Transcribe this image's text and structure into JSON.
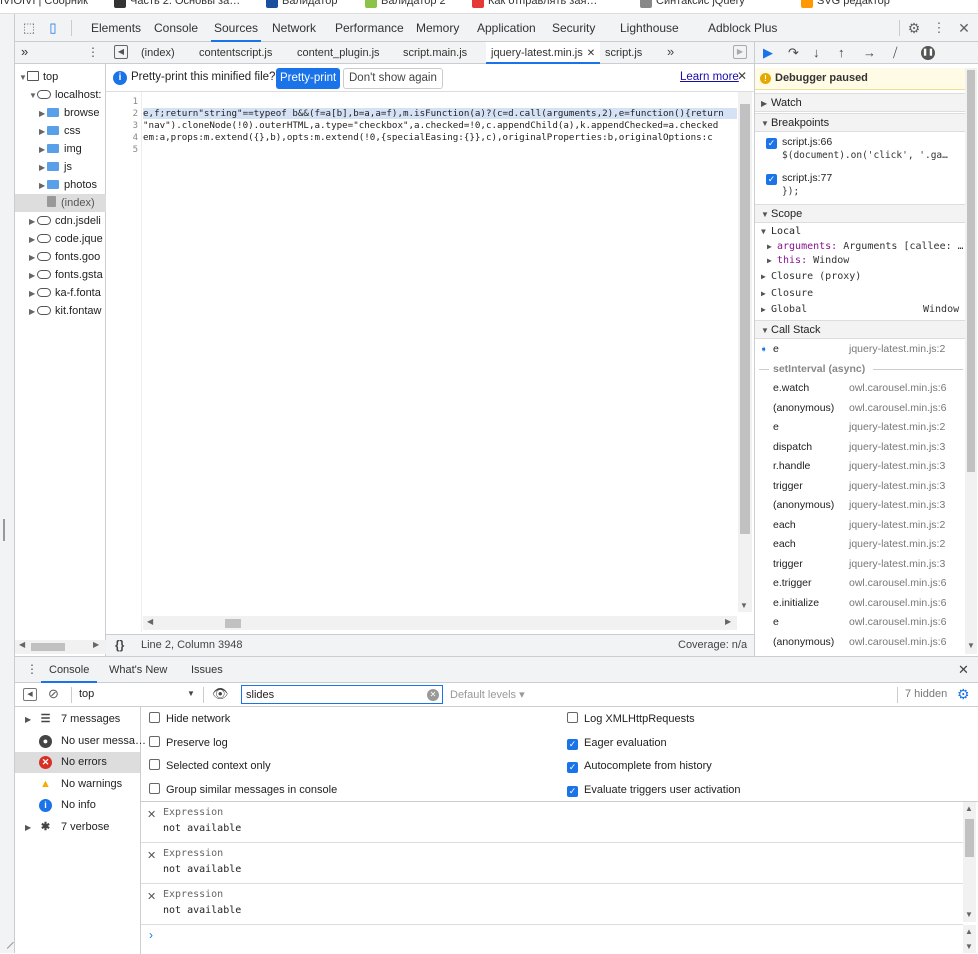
{
  "bookmarks": [
    {
      "label": "IVIOIVI | Сборник",
      "icon_color": "#ffffff"
    },
    {
      "label": "Часть 2. Основы за…",
      "icon_color": "#333333"
    },
    {
      "label": "Валидатор",
      "icon_color": "#1a4fa0"
    },
    {
      "label": "Валидатор 2",
      "icon_color": "#8bc34a"
    },
    {
      "label": "Как отправлять зая…",
      "icon_color": "#e53935"
    },
    {
      "label": "Синтаксис jQuery",
      "icon_color": "#888888"
    },
    {
      "label": "SVG редактор",
      "icon_color": "#ff9800"
    }
  ],
  "toolbar": {
    "tabs": [
      "Elements",
      "Console",
      "Sources",
      "Network",
      "Performance",
      "Memory",
      "Application",
      "Security",
      "Lighthouse",
      "Adblock Plus"
    ],
    "active_tab": "Sources",
    "icons": [
      "inspect-icon",
      "device-toggle-icon",
      "gear-icon",
      "more-icon",
      "close-icon"
    ]
  },
  "navigator": {
    "more": "»",
    "items": [
      {
        "label": "top",
        "type": "frame",
        "expanded": true
      },
      {
        "label": "localhost:",
        "type": "cloud",
        "expanded": true
      },
      {
        "label": "browse",
        "type": "folder"
      },
      {
        "label": "css",
        "type": "folder"
      },
      {
        "label": "img",
        "type": "folder"
      },
      {
        "label": "js",
        "type": "folder"
      },
      {
        "label": "photos",
        "type": "folder"
      },
      {
        "label": "(index)",
        "type": "file"
      },
      {
        "label": "cdn.jsdeli",
        "type": "cloud"
      },
      {
        "label": "code.jque",
        "type": "cloud"
      },
      {
        "label": "fonts.goo",
        "type": "cloud"
      },
      {
        "label": "fonts.gsta",
        "type": "cloud"
      },
      {
        "label": "ka-f.fonta",
        "type": "cloud"
      },
      {
        "label": "kit.fontaw",
        "type": "cloud"
      }
    ]
  },
  "editor": {
    "tabs": [
      "(index)",
      "contentscript.js",
      "content_plugin.js",
      "script.main.js",
      "jquery-latest.min.js",
      "script.js"
    ],
    "active_tab": "jquery-latest.min.js",
    "more": "»",
    "infobar": {
      "text": "Pretty-print this minified file?",
      "pretty_btn": "Pretty-print",
      "dont_btn": "Don't show again",
      "learn": "Learn more"
    },
    "lines": [
      {
        "n": "1",
        "code": ""
      },
      {
        "n": "2",
        "code": "e,f;return\"string\"==typeof b&&(f=a[b],b=a,a=f),m.isFunction(a)?(c=d.call(arguments,2),e=function(){return"
      },
      {
        "n": "3",
        "code": "\"nav\").cloneNode(!0).outerHTML,a.type=\"checkbox\",a.checked=!0,c.appendChild(a),k.appendChecked=a.checked"
      },
      {
        "n": "4",
        "code": "em:a,props:m.extend({},b),opts:m.extend(!0,{specialEasing:{}},c),originalProperties:b,originalOptions:c"
      },
      {
        "n": "5",
        "code": ""
      }
    ],
    "status": {
      "braces": "{}",
      "position": "Line 2, Column 3948",
      "coverage": "Coverage: n/a"
    }
  },
  "debugger": {
    "paused": "Debugger paused",
    "watch": "Watch",
    "breakpoints_title": "Breakpoints",
    "breakpoints": [
      {
        "file": "script.js:66",
        "code": "$(document).on('click', '.ga…"
      },
      {
        "file": "script.js:77",
        "code": "});"
      }
    ],
    "scope_title": "Scope",
    "local": "Local",
    "arguments_key": "arguments:",
    "arguments_val": "Arguments [callee: …",
    "this_key": "this:",
    "this_val": "Window",
    "closure_proxy": "Closure (proxy)",
    "closure": "Closure",
    "global": "Global",
    "global_val": "Window",
    "callstack_title": "Call Stack",
    "async_label": "setInterval (async)",
    "stack": [
      {
        "fn": "e",
        "loc": "jquery-latest.min.js:2",
        "current": true
      },
      {
        "fn": "e.watch",
        "loc": "owl.carousel.min.js:6"
      },
      {
        "fn": "(anonymous)",
        "loc": "owl.carousel.min.js:6"
      },
      {
        "fn": "e",
        "loc": "jquery-latest.min.js:2"
      },
      {
        "fn": "dispatch",
        "loc": "jquery-latest.min.js:3"
      },
      {
        "fn": "r.handle",
        "loc": "jquery-latest.min.js:3"
      },
      {
        "fn": "trigger",
        "loc": "jquery-latest.min.js:3"
      },
      {
        "fn": "(anonymous)",
        "loc": "jquery-latest.min.js:3"
      },
      {
        "fn": "each",
        "loc": "jquery-latest.min.js:2"
      },
      {
        "fn": "each",
        "loc": "jquery-latest.min.js:2"
      },
      {
        "fn": "trigger",
        "loc": "jquery-latest.min.js:3"
      },
      {
        "fn": "e.trigger",
        "loc": "owl.carousel.min.js:6"
      },
      {
        "fn": "e.initialize",
        "loc": "owl.carousel.min.js:6"
      },
      {
        "fn": "e",
        "loc": "owl.carousel.min.js:6"
      },
      {
        "fn": "(anonymous)",
        "loc": "owl.carousel.min.js:6"
      }
    ]
  },
  "drawer": {
    "tabs": [
      "Console",
      "What's New",
      "Issues"
    ],
    "active_tab": "Console",
    "context": "top",
    "filter_value": "slides",
    "levels": "Default levels ▾",
    "hidden": "7 hidden",
    "sidebar": [
      {
        "label": "7 messages",
        "icon": "list-icon",
        "color": "#444"
      },
      {
        "label": "No user messa…",
        "icon": "user-icon",
        "color": "#444"
      },
      {
        "label": "No errors",
        "icon": "error-icon",
        "color": "#d93025"
      },
      {
        "label": "No warnings",
        "icon": "warning-icon",
        "color": "#f9ab00"
      },
      {
        "label": "No info",
        "icon": "info-icon",
        "color": "#1a73e8"
      },
      {
        "label": "7 verbose",
        "icon": "bug-icon",
        "color": "#444"
      }
    ],
    "settings_left": [
      {
        "label": "Hide network",
        "checked": false
      },
      {
        "label": "Preserve log",
        "checked": false
      },
      {
        "label": "Selected context only",
        "checked": false
      },
      {
        "label": "Group similar messages in console",
        "checked": false
      }
    ],
    "settings_right": [
      {
        "label": "Log XMLHttpRequests",
        "checked": false
      },
      {
        "label": "Eager evaluation",
        "checked": true
      },
      {
        "label": "Autocomplete from history",
        "checked": true
      },
      {
        "label": "Evaluate triggers user activation",
        "checked": true
      }
    ],
    "expressions": [
      {
        "label": "Expression",
        "value": "not available"
      },
      {
        "label": "Expression",
        "value": "not available"
      },
      {
        "label": "Expression",
        "value": "not available"
      }
    ],
    "prompt": "›"
  }
}
